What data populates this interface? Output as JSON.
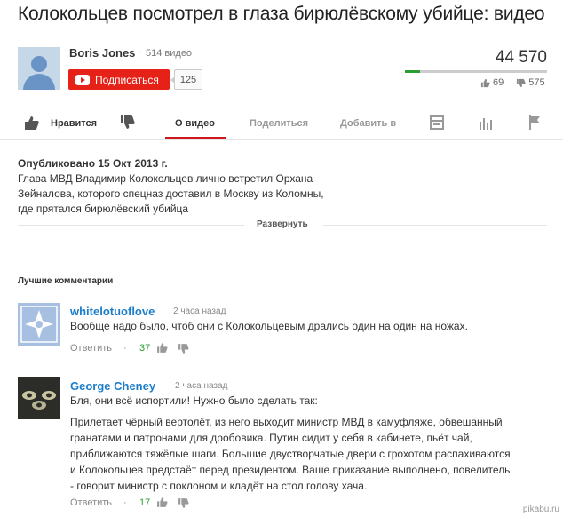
{
  "video": {
    "title": "Колокольцев посмотрел в глаза бирюлёвскому убийце: видео",
    "views": "44 570",
    "likes": "69",
    "dislikes": "575",
    "like_ratio": 0.107
  },
  "channel": {
    "name": "Boris Jones",
    "separator": "·",
    "video_count": "514 видео",
    "subscribe_label": "Подписаться",
    "subscriber_count": "125"
  },
  "actions": {
    "like_label": "Нравится",
    "tabs": [
      {
        "label": "О видео",
        "active": true
      },
      {
        "label": "Поделиться",
        "active": false
      },
      {
        "label": "Добавить в",
        "active": false
      }
    ],
    "icons": [
      "thumbs-up-icon",
      "thumbs-down-icon",
      "transcript-icon",
      "stats-icon",
      "flag-icon"
    ]
  },
  "description": {
    "published": "Опубликовано 15 Окт 2013 г.",
    "lines": [
      "Глава МВД Владимир Колокольцев лично встретил Орхана",
      "Зейналова, которого спецназ доставил в Москву из Коломны,",
      "где прятался бирюлёвский убийца"
    ],
    "expand_label": "Развернуть"
  },
  "comments_section": {
    "heading": "Лучшие комментарии",
    "comments": [
      {
        "author": "whitelotuoflove",
        "time": "2 часа назад",
        "lines": [
          "Вообще надо было, чтоб они с Колокольцевым дрались один на один на ножах."
        ],
        "reply_label": "Ответить",
        "separator": "·",
        "likes": "37"
      },
      {
        "author": "George Cheney",
        "time": "2 часа назад",
        "lines": [
          "Бля, они всё испортили! Нужно было сделать так:",
          "",
          "Прилетает чёрный вертолёт, из него выходит министр МВД в камуфляже, обвешанный",
          "гранатами и патронами для дробовика. Путин сидит у себя в кабинете, пьёт чай,",
          "приближаются тяжёлые шаги. Большие двустворчатые двери с грохотом распахиваются",
          "и Колокольцев предстаёт перед президентом. Ваше приказание выполнено, повелитель",
          "- говорит министр с поклоном и кладёт на стол голову хача."
        ],
        "reply_label": "Ответить",
        "separator": "·",
        "likes": "17"
      }
    ]
  },
  "watermark": "pikabu.ru",
  "colors": {
    "subscribe": "#e62117",
    "accent_tab": "#cc181e",
    "link": "#1b7dcc",
    "positive": "#2b9e31"
  }
}
